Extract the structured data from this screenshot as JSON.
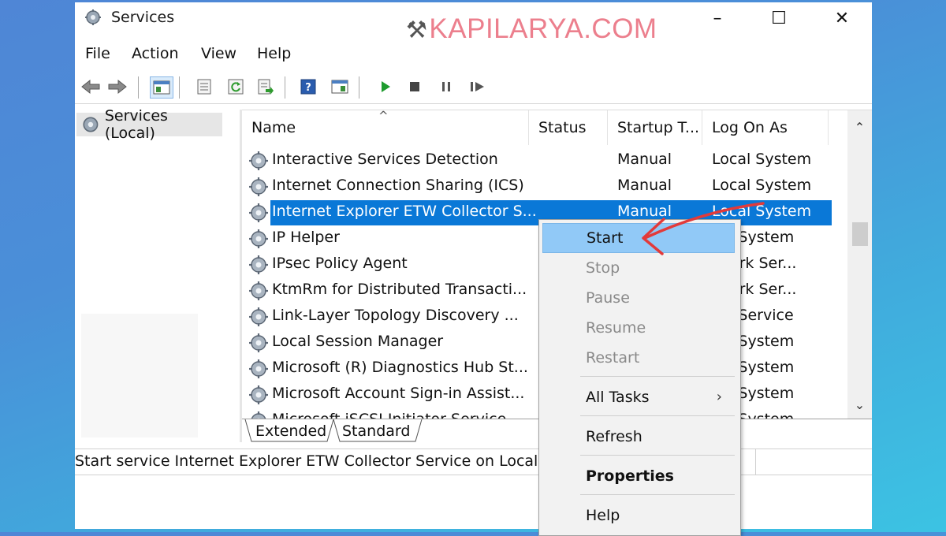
{
  "window": {
    "title": "Services",
    "watermark": "KAPILARYA.COM",
    "controls": {
      "minimize": "–",
      "maximize": "☐",
      "close": "✕"
    }
  },
  "menu": [
    "File",
    "Action",
    "View",
    "Help"
  ],
  "toolbar": [
    "back",
    "forward",
    "show-tree",
    "properties",
    "refresh",
    "export",
    "help",
    "show-console",
    "start",
    "stop",
    "pause",
    "restart"
  ],
  "tree": {
    "label": "Services (Local)"
  },
  "table": {
    "columns": [
      "Name",
      "Status",
      "Startup T...",
      "Log On As"
    ],
    "rows": [
      {
        "name": "Interactive Services Detection",
        "status": "",
        "startup": "Manual",
        "logon": "Local System"
      },
      {
        "name": "Internet Connection Sharing (ICS)",
        "status": "",
        "startup": "Manual",
        "logon": "Local System"
      },
      {
        "name": "Internet Explorer ETW Collector S...",
        "status": "",
        "startup": "Manual",
        "logon": "Local System",
        "selected": true
      },
      {
        "name": "IP Helper",
        "status": "",
        "startup": "",
        "logon": "cal System"
      },
      {
        "name": "IPsec Policy Agent",
        "status": "",
        "startup": "",
        "logon": "twork Ser..."
      },
      {
        "name": "KtmRm for Distributed Transacti...",
        "status": "",
        "startup": "",
        "logon": "twork Ser..."
      },
      {
        "name": "Link-Layer Topology Discovery ...",
        "status": "",
        "startup": "",
        "logon": "cal Service"
      },
      {
        "name": "Local Session Manager",
        "status": "",
        "startup": "",
        "logon": "cal System"
      },
      {
        "name": "Microsoft (R) Diagnostics Hub St...",
        "status": "",
        "startup": "",
        "logon": "cal System"
      },
      {
        "name": "Microsoft Account Sign-in Assist...",
        "status": "",
        "startup": "",
        "logon": "cal System"
      },
      {
        "name": "Microsoft iSCSI Initiator Service",
        "status": "",
        "startup": "",
        "logon": "cal System"
      }
    ]
  },
  "tabs": [
    "Extended",
    "Standard"
  ],
  "statusbar": {
    "text": "Start service Internet Explorer ETW Collector Service on Local Cor"
  },
  "context_menu": {
    "items": [
      {
        "label": "Start",
        "state": "highlighted"
      },
      {
        "label": "Stop",
        "state": "disabled"
      },
      {
        "label": "Pause",
        "state": "disabled"
      },
      {
        "label": "Resume",
        "state": "disabled"
      },
      {
        "label": "Restart",
        "state": "disabled"
      },
      {
        "label": "All Tasks",
        "state": "submenu",
        "arrow": "›"
      },
      {
        "label": "Refresh",
        "state": "normal"
      },
      {
        "label": "Properties",
        "state": "bold"
      },
      {
        "label": "Help",
        "state": "normal"
      }
    ]
  },
  "colors": {
    "selection": "#0a78d7",
    "menu_highlight": "#91c9f7",
    "annotation_arrow": "#e23a3a",
    "watermark": "#ec7f8d"
  },
  "annotation": {
    "type": "red-arrow",
    "points_to": "Start"
  }
}
